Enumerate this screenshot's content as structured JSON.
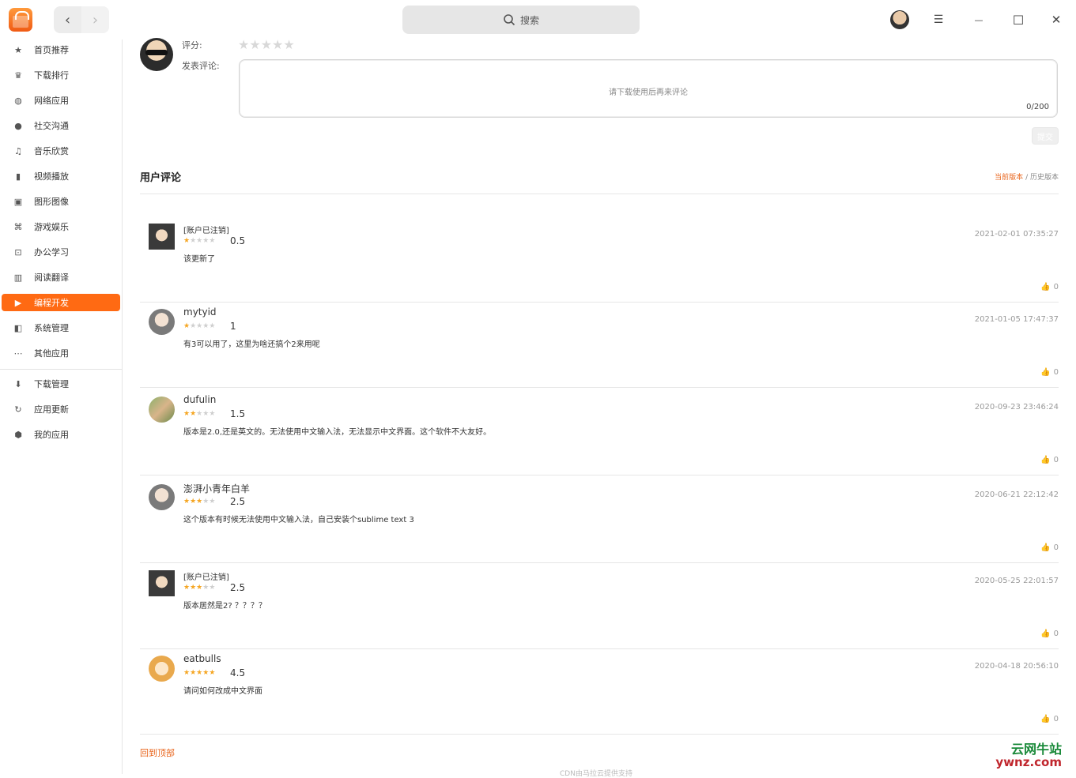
{
  "titlebar": {
    "search_placeholder": "搜索",
    "back_label": "‹",
    "forward_label": "›",
    "menu_label": "☰",
    "minimize_label": "—",
    "maximize_label": "☐",
    "close_label": "✕"
  },
  "sidebar": {
    "items": [
      {
        "label": "首页推荐",
        "icon": "star-icon"
      },
      {
        "label": "下载排行",
        "icon": "crown-icon"
      },
      {
        "label": "网络应用",
        "icon": "globe-icon"
      },
      {
        "label": "社交沟通",
        "icon": "chat-icon"
      },
      {
        "label": "音乐欣赏",
        "icon": "music-icon"
      },
      {
        "label": "视频播放",
        "icon": "film-icon"
      },
      {
        "label": "图形图像",
        "icon": "image-icon"
      },
      {
        "label": "游戏娱乐",
        "icon": "gamepad-icon"
      },
      {
        "label": "办公学习",
        "icon": "presentation-icon"
      },
      {
        "label": "阅读翻译",
        "icon": "book-icon"
      },
      {
        "label": "编程开发",
        "icon": "terminal-icon",
        "active": true
      },
      {
        "label": "系统管理",
        "icon": "system-icon"
      },
      {
        "label": "其他应用",
        "icon": "more-icon"
      }
    ],
    "bottom_items": [
      {
        "label": "下载管理",
        "icon": "download-icon"
      },
      {
        "label": "应用更新",
        "icon": "refresh-icon"
      },
      {
        "label": "我的应用",
        "icon": "box-icon"
      }
    ]
  },
  "comment_form": {
    "rating_label": "评分:",
    "comment_label": "发表评论:",
    "placeholder": "请下载使用后再来评论",
    "char_count": "0/200",
    "submit_label": "提交",
    "rating_value": 0
  },
  "reviews_section": {
    "title": "用户评论",
    "current_version": "当前版本",
    "separator": "/",
    "history_version": "历史版本"
  },
  "reviews": [
    {
      "name": "[账户已注销]",
      "score": "0.5",
      "rating": 0.5,
      "text": "该更新了",
      "date": "2021-02-01 07:35:27",
      "likes": "0",
      "avatar": "bearded-avatar-icon"
    },
    {
      "name": "mytyid",
      "score": "1",
      "rating": 1,
      "text": "有3可以用了，这里为啥还搞个2来用呢",
      "date": "2021-01-05 17:47:37",
      "likes": "0",
      "avatar": "default-avatar-icon"
    },
    {
      "name": "dufulin",
      "score": "1.5",
      "rating": 1.5,
      "text": "版本是2.0,还是英文的。无法使用中文输入法，无法显示中文界面。这个软件不大友好。",
      "date": "2020-09-23 23:46:24",
      "likes": "0",
      "avatar": "photo-avatar-icon"
    },
    {
      "name": "澎湃小青年白羊",
      "score": "2.5",
      "rating": 2.5,
      "text": "这个版本有时候无法使用中文输入法，自己安装个sublime text 3",
      "date": "2020-06-21 22:12:42",
      "likes": "0",
      "avatar": "default-avatar-icon"
    },
    {
      "name": "[账户已注销]",
      "score": "2.5",
      "rating": 2.5,
      "text": "版本居然是2? ？？？？",
      "date": "2020-05-25 22:01:57",
      "likes": "0",
      "avatar": "bearded-avatar-icon"
    },
    {
      "name": "eatbulls",
      "score": "4.5",
      "rating": 4.5,
      "text": "请问如何改成中文界面",
      "date": "2020-04-18 20:56:10",
      "likes": "0",
      "avatar": "cartoon-avatar-icon"
    }
  ],
  "footer": {
    "back_to_top": "回到顶部",
    "cdn_text": "CDN由马拉云提供支持"
  },
  "watermark": {
    "line1": "云网牛站",
    "line2": "ywnz.com"
  },
  "colors": {
    "accent": "#ff6a13",
    "star_on": "#f5a623",
    "link": "#e8641b"
  }
}
